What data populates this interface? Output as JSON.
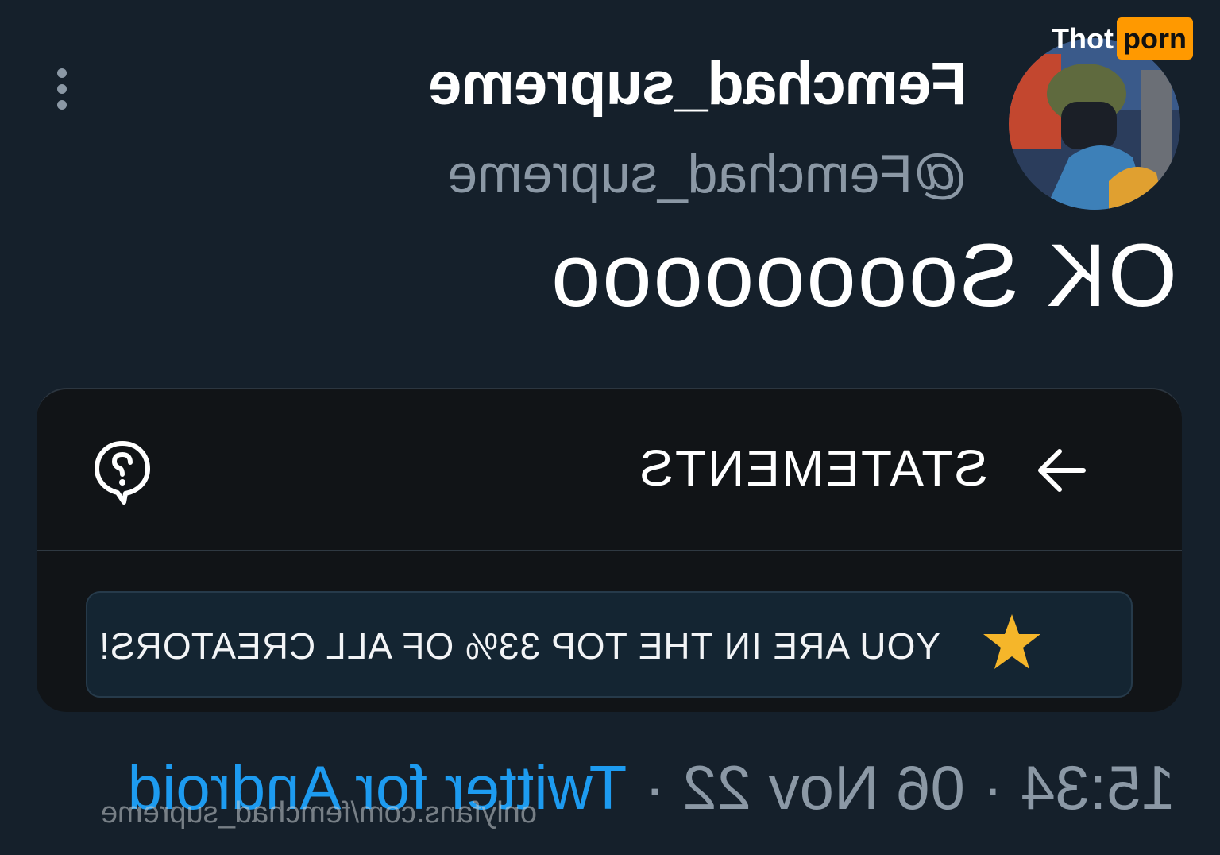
{
  "tweet": {
    "display_name": "Femchad_supreme",
    "handle": "@Femchad_supreme",
    "text": "OK Soooooooo",
    "more_icon": "more-vertical-icon",
    "avatar_icon": "avatar"
  },
  "card": {
    "statements_label": "STATEMENTS",
    "arrow_icon": "arrow-right-icon",
    "help_icon": "help-bubble-icon",
    "rank_text": "YOU ARE IN THE TOP 33% OF ALL CREATORS!",
    "star_icon": "star-icon",
    "star_color": "#f5b62a"
  },
  "meta": {
    "time": "15:34",
    "date": "06 Nov 22",
    "separator": "·",
    "source": "Twitter for Android"
  },
  "watermarks": {
    "url": "onlyfans.com/femchad_supreme",
    "logo_part1": "Thot",
    "logo_part2": "porn"
  },
  "colors": {
    "background": "#15202b",
    "secondary_text": "#8b98a5",
    "link": "#1d9bf0",
    "card_bg": "#111417",
    "banner_bg": "#142532"
  }
}
